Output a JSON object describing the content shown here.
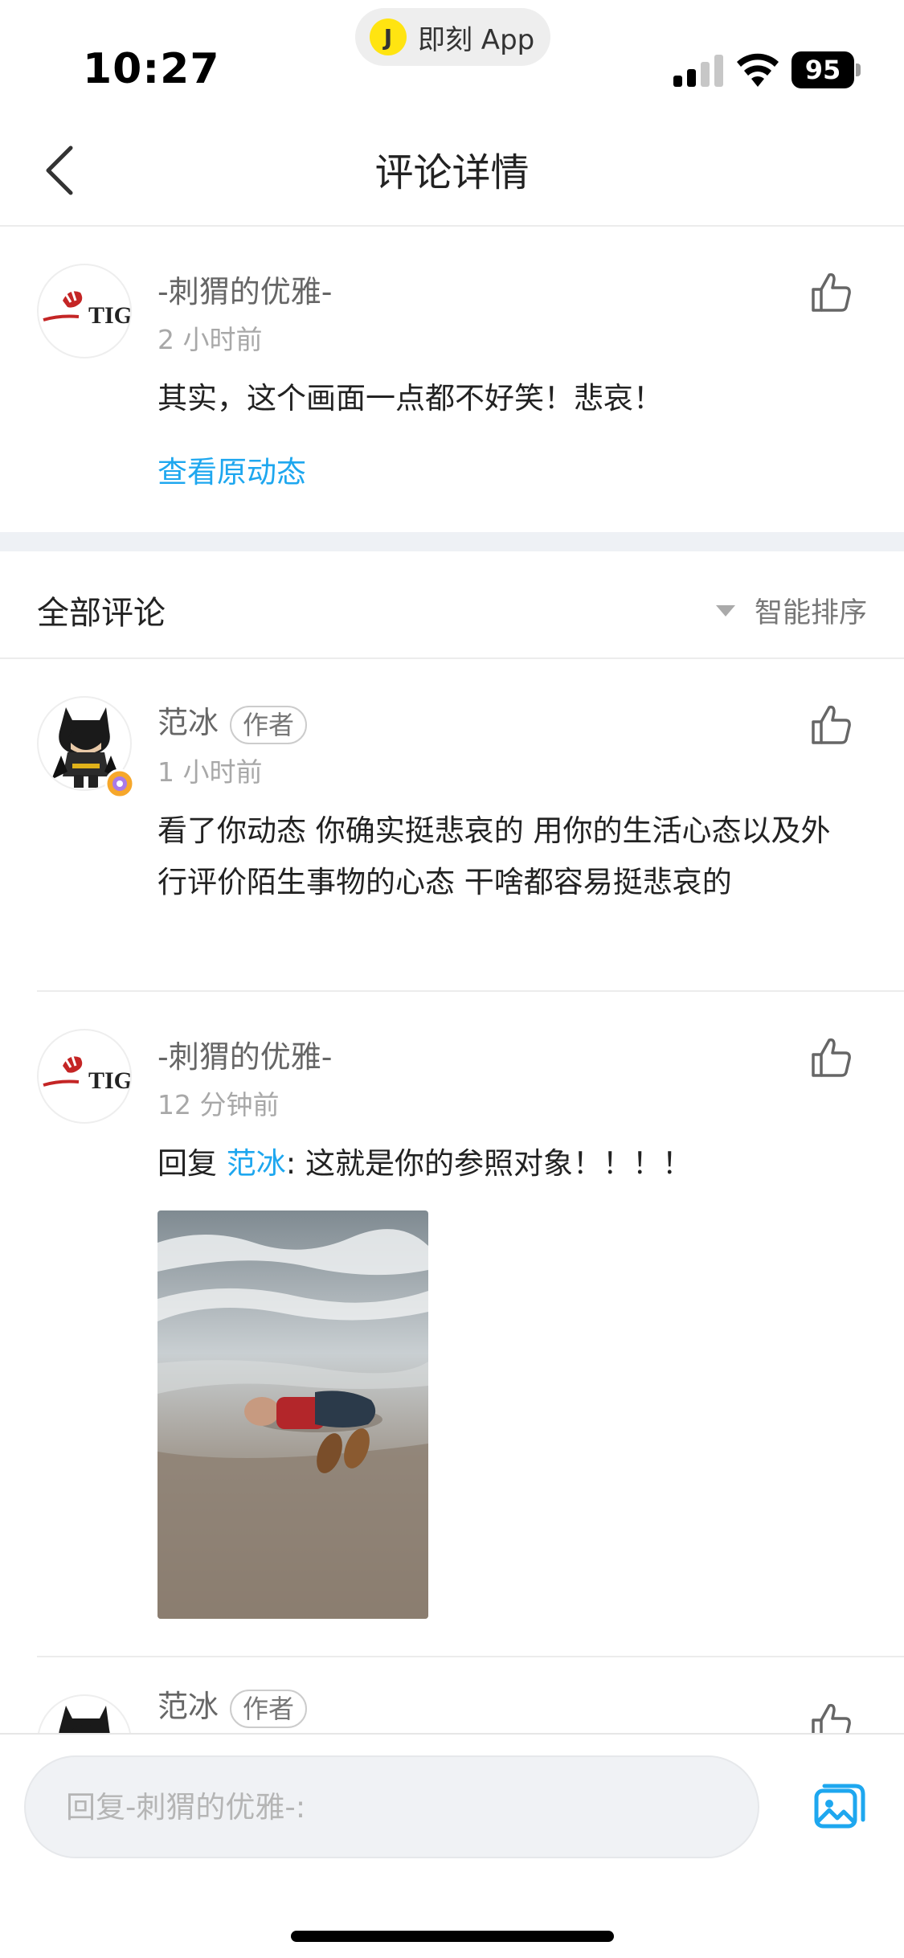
{
  "status": {
    "time": "10:27",
    "app_pill": "即刻 App",
    "app_pill_logo": "J",
    "battery": "95"
  },
  "nav": {
    "title": "评论详情"
  },
  "main_comment": {
    "author": "-刺猬的优雅-",
    "time": "2 小时前",
    "text": "其实，这个画面一点都不好笑！悲哀！",
    "view_original": "查看原动态",
    "avatar_text": "TIG"
  },
  "section": {
    "label": "全部评论",
    "sort_label": "智能排序"
  },
  "replies": [
    {
      "author": "范冰",
      "badge": "作者",
      "time": "1 小时前",
      "text": "看了你动态 你确实挺悲哀的 用你的生活心态以及外行评价陌生事物的心态 干啥都容易挺悲哀的"
    },
    {
      "author": "-刺猬的优雅-",
      "time": "12 分钟前",
      "reply_prefix": "回复 ",
      "reply_to": "范冰",
      "text": ": 这就是你的参照对象！！！！",
      "avatar_text": "TIG"
    },
    {
      "author": "范冰",
      "badge": "作者"
    }
  ],
  "bottom": {
    "placeholder": "回复-刺猬的优雅-:"
  },
  "colors": {
    "link": "#1ea7ef",
    "accent_yellow": "#ffe411"
  }
}
